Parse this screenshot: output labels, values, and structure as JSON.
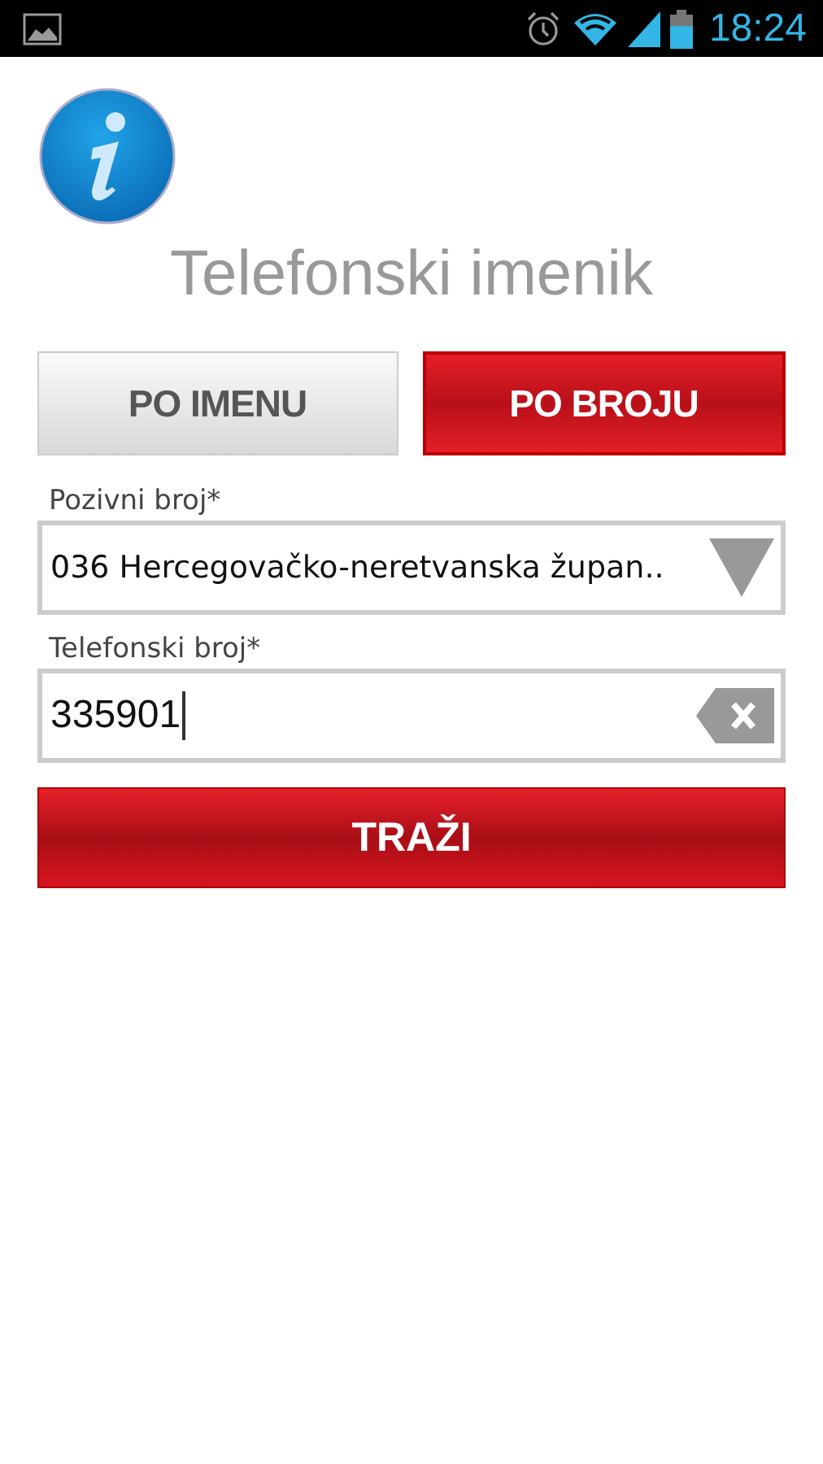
{
  "status_bar": {
    "time": "18:24"
  },
  "title": "Telefonski imenik",
  "tabs": [
    {
      "label": "PO IMENU",
      "selected": false
    },
    {
      "label": "PO BROJU",
      "selected": true
    }
  ],
  "fields": [
    {
      "kind": "dropdown",
      "label": "Pozivni broj*",
      "value": "036 Hercegovačko-neretvanska župan.."
    },
    {
      "kind": "text",
      "label": "Telefonski broj*",
      "value": "335901",
      "focused": true
    }
  ],
  "button": {
    "label": "TRAŽI"
  }
}
